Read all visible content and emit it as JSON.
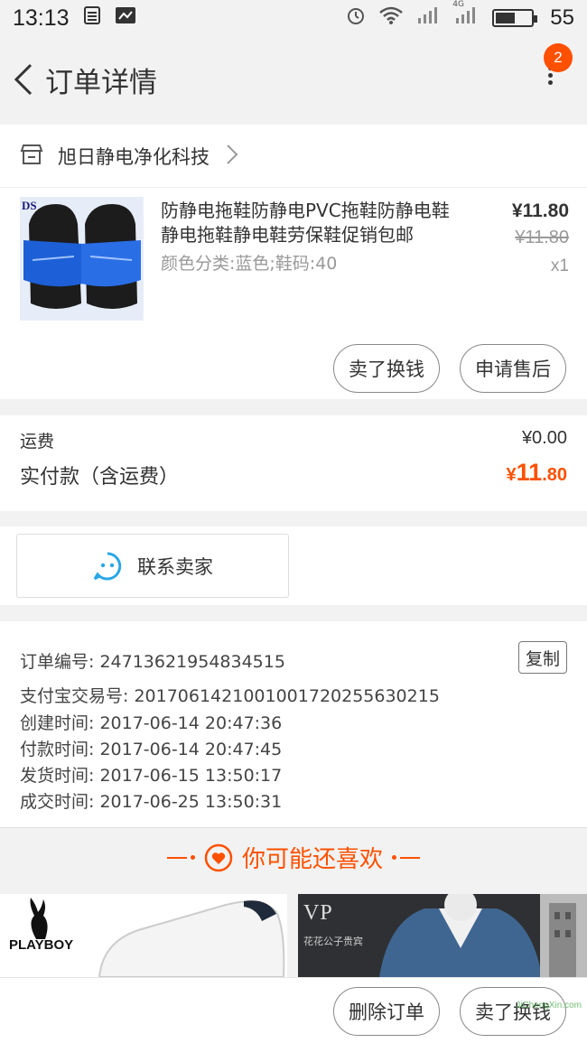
{
  "status_bar": {
    "time": "13:13",
    "network": "4G",
    "battery": "55",
    "battery_level_pct": 55
  },
  "nav": {
    "title": "订单详情",
    "badge_count": "2"
  },
  "shop": {
    "name": "旭日静电净化科技"
  },
  "item": {
    "title": "防静电拖鞋防静电PVC拖鞋防静电鞋静电拖鞋静电鞋劳保鞋促销包邮",
    "sku": "颜色分类:蓝色;鞋码:40",
    "price": "¥11.80",
    "original_price": "¥11.80",
    "quantity": "x1",
    "thumb_label": "DS",
    "btn_sell": "卖了换钱",
    "btn_after_sale": "申请售后"
  },
  "fees": {
    "shipping_label": "运费",
    "shipping_value": "¥0.00",
    "paid_label": "实付款（含运费）",
    "paid_symbol": "¥",
    "paid_int": "11",
    "paid_dec": ".80"
  },
  "contact": {
    "label": "联系卖家"
  },
  "order_info": {
    "copy_label": "复制",
    "rows": [
      "订单编号: 24713621954834515",
      "支付宝交易号: 2017061421001001720255630215",
      "创建时间: 2017-06-14 20:47:36",
      "付款时间: 2017-06-14 20:47:45",
      "发货时间: 2017-06-15 13:50:17",
      "成交时间: 2017-06-25 13:50:31"
    ]
  },
  "recommend": {
    "title": "你可能还喜欢",
    "brand1": "PLAYBOY",
    "brand2": "VP",
    "brand2_sub": "花花公子贵宾"
  },
  "bottom": {
    "delete_label": "删除订单",
    "sell_label": "卖了换钱"
  },
  "watermark": "JiChengXin.com",
  "colors": {
    "accent": "#ff5000",
    "service_blue": "#27a7e7"
  }
}
